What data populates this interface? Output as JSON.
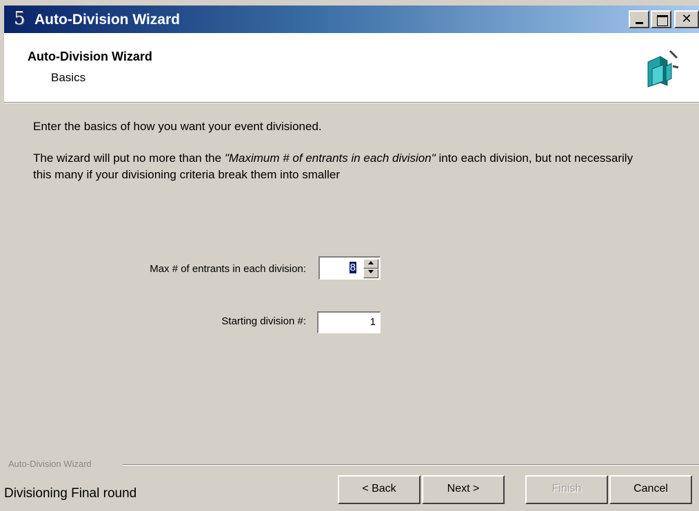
{
  "window": {
    "title": "Auto-Division Wizard",
    "app_icon_glyph": "5",
    "controls": {
      "minimize": "minimize",
      "maximize": "maximize",
      "close": "✕"
    }
  },
  "header": {
    "title": "Auto-Division Wizard",
    "subtitle": "Basics",
    "icon": "wizard-icon"
  },
  "body": {
    "intro": "Enter the basics of how you want your event divisioned.",
    "explain_prefix": "The wizard will put no more than the ",
    "explain_quote": "\"Maximum # of entrants in each division\"",
    "explain_suffix": "  into each division, but not necessarily this many if your divisioning criteria break them into smaller"
  },
  "fields": {
    "max_label": "Max # of entrants in each division:",
    "max_value": "8",
    "start_label": "Starting division #:",
    "start_value": "1"
  },
  "footer": {
    "group_label": "Auto-Division Wizard",
    "status": "Divisioning Final round",
    "buttons": {
      "back": "< Back",
      "next": "Next >",
      "finish": "Finish",
      "cancel": "Cancel"
    }
  },
  "colors": {
    "titlebar_start": "#0a246a",
    "titlebar_end": "#a6caf0",
    "face": "#d4d0c8"
  }
}
